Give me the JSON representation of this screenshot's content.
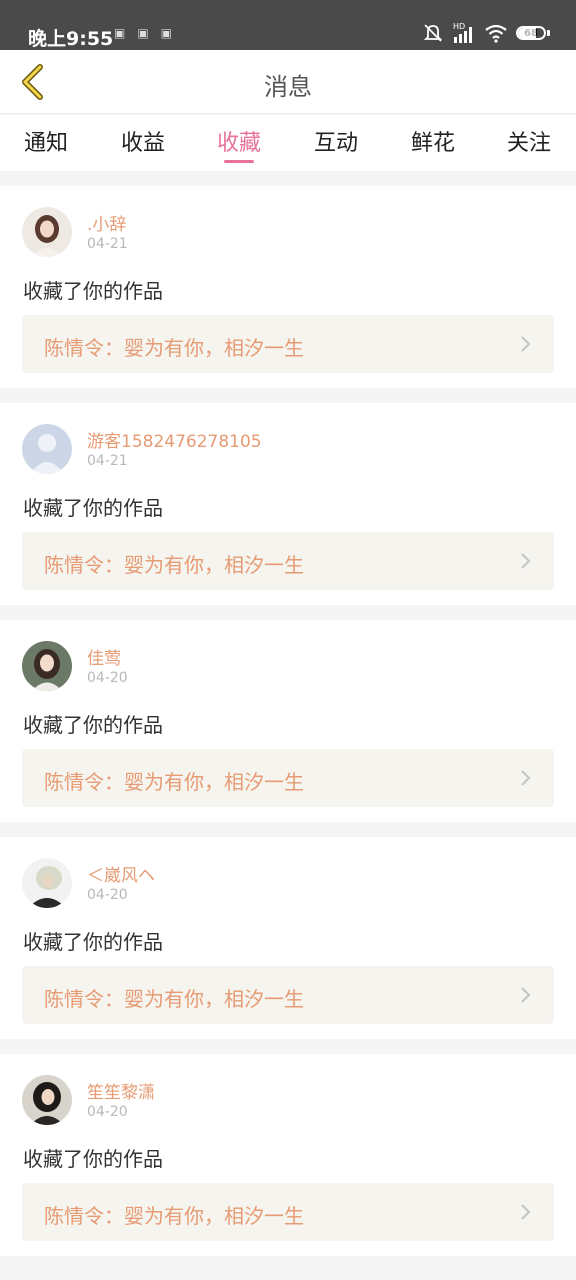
{
  "status_bar": {
    "time": "晚上9:55",
    "notification_icons": [
      "app-icon",
      "app-icon",
      "app-icon"
    ],
    "network": "HD",
    "battery": "68",
    "battery_level": 0.68
  },
  "nav": {
    "title": "消息"
  },
  "tabs": [
    {
      "label": "通知"
    },
    {
      "label": "收益"
    },
    {
      "label": "收藏"
    },
    {
      "label": "互动"
    },
    {
      "label": "鲜花"
    },
    {
      "label": "关注"
    }
  ],
  "active_tab": "收藏",
  "colors": {
    "accent": "#e8729a",
    "username": "#e79b74",
    "work_bg": "#f5f4ee"
  },
  "feed": [
    {
      "username": ".小辞",
      "date": "04-21",
      "action": "收藏了你的作品",
      "work_title": "陈情令：婴为有你，相汐一生"
    },
    {
      "username": "游客1582476278105",
      "date": "04-21",
      "action": "收藏了你的作品",
      "work_title": "陈情令：婴为有你，相汐一生"
    },
    {
      "username": "佳莺",
      "date": "04-20",
      "action": "收藏了你的作品",
      "work_title": "陈情令：婴为有你，相汐一生"
    },
    {
      "username": "＜崴风ヘ",
      "date": "04-20",
      "action": "收藏了你的作品",
      "work_title": "陈情令：婴为有你，相汐一生"
    },
    {
      "username": "笙笙黎潇",
      "date": "04-20",
      "action": "收藏了你的作品",
      "work_title": "陈情令：婴为有你，相汐一生"
    }
  ]
}
